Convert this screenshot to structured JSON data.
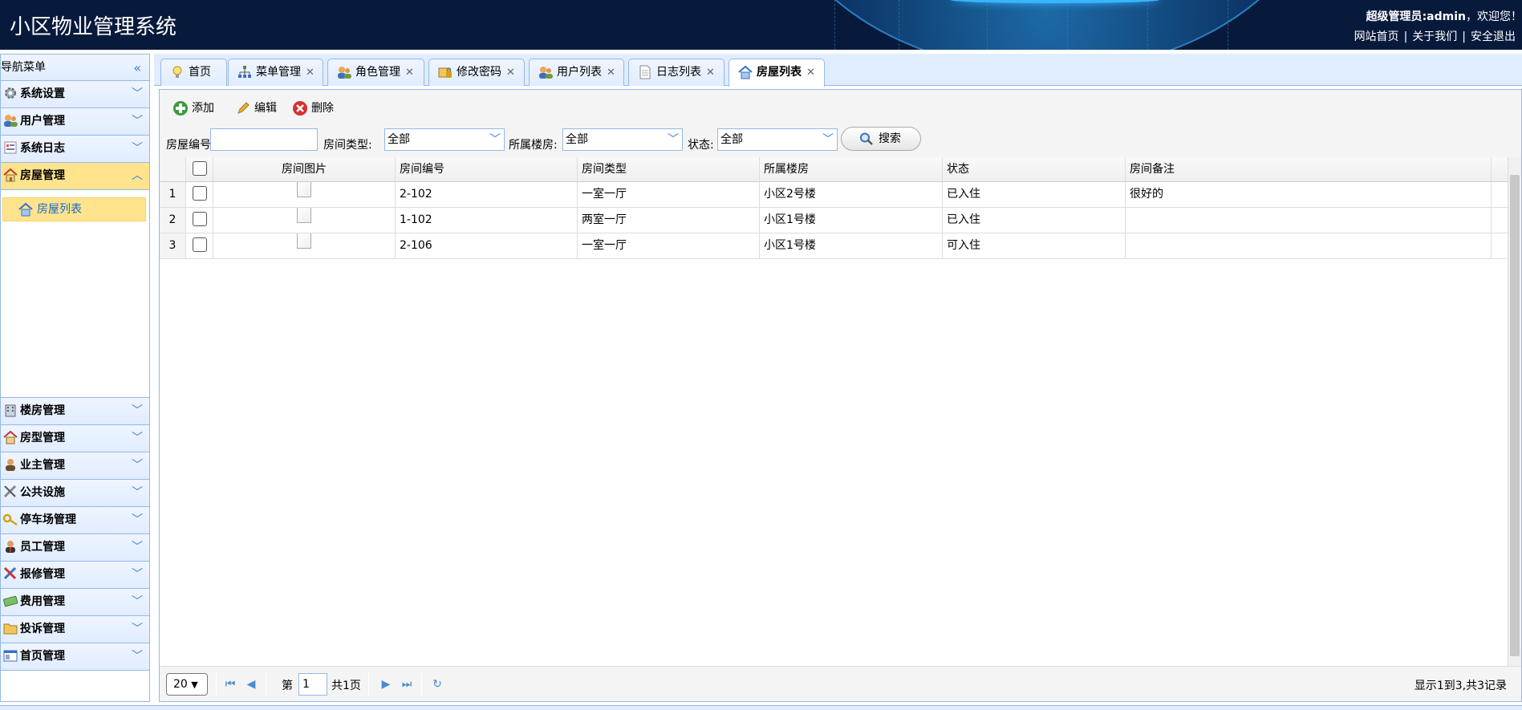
{
  "header": {
    "title": "小区物业管理系统",
    "user_role": "超级管理员",
    "user_name": "admin",
    "welcome": "，欢迎您！",
    "links": [
      "网站首页",
      "关于我们",
      "安全退出"
    ]
  },
  "sidebar": {
    "title": "导航菜单",
    "groups_top": [
      {
        "label": "系统设置",
        "icon": "gear-icon"
      },
      {
        "label": "用户管理",
        "icon": "users-icon"
      },
      {
        "label": "系统日志",
        "icon": "log-icon"
      },
      {
        "label": "房屋管理",
        "icon": "house-icon",
        "active": true
      }
    ],
    "sub_items": [
      {
        "label": "房屋列表",
        "icon": "house-icon",
        "active": true
      }
    ],
    "groups_bottom": [
      {
        "label": "楼房管理",
        "icon": "building-icon"
      },
      {
        "label": "房型管理",
        "icon": "house-icon"
      },
      {
        "label": "业主管理",
        "icon": "person-icon"
      },
      {
        "label": "公共设施",
        "icon": "tools-icon"
      },
      {
        "label": "停车场管理",
        "icon": "key-icon"
      },
      {
        "label": "员工管理",
        "icon": "employee-icon"
      },
      {
        "label": "报修管理",
        "icon": "repair-icon"
      },
      {
        "label": "费用管理",
        "icon": "money-icon"
      },
      {
        "label": "投诉管理",
        "icon": "folder-icon"
      },
      {
        "label": "首页管理",
        "icon": "layout-icon"
      }
    ]
  },
  "tabs": [
    {
      "label": "首页",
      "icon": "bulb-icon",
      "closable": false
    },
    {
      "label": "菜单管理",
      "icon": "sitemap-icon",
      "closable": true
    },
    {
      "label": "角色管理",
      "icon": "users-icon",
      "closable": true
    },
    {
      "label": "修改密码",
      "icon": "lock-icon",
      "closable": true
    },
    {
      "label": "用户列表",
      "icon": "users-icon",
      "closable": true
    },
    {
      "label": "日志列表",
      "icon": "log-icon",
      "closable": true
    },
    {
      "label": "房屋列表",
      "icon": "house-icon",
      "closable": true,
      "active": true
    }
  ],
  "toolbar": {
    "add": "添加",
    "edit": "编辑",
    "delete": "删除"
  },
  "search": {
    "house_no_label": "房屋编号:",
    "house_no_value": "",
    "room_type_label": "房间类型:",
    "room_type_value": "全部",
    "building_label": "所属楼房:",
    "building_value": "全部",
    "status_label": "状态:",
    "status_value": "全部",
    "search_button": "搜索"
  },
  "table": {
    "columns": [
      "房间图片",
      "房间编号",
      "房间类型",
      "所属楼房",
      "状态",
      "房间备注"
    ],
    "rows": [
      {
        "num": "1",
        "no": "2-102",
        "type": "一室一厅",
        "building": "小区2号楼",
        "status": "已入住",
        "note": "很好的"
      },
      {
        "num": "2",
        "no": "1-102",
        "type": "两室一厅",
        "building": "小区1号楼",
        "status": "已入住",
        "note": ""
      },
      {
        "num": "3",
        "no": "2-106",
        "type": "一室一厅",
        "building": "小区1号楼",
        "status": "可入住",
        "note": ""
      }
    ]
  },
  "pager": {
    "page_size": "20",
    "page_prefix": "第",
    "page_current": "1",
    "page_total": "共1页",
    "info": "显示1到3,共3记录"
  },
  "colors": {
    "header_bg": "#081a3c",
    "border": "#95b8e7",
    "active_bg": "#ffe48d",
    "accent": "#3b7fd1"
  }
}
